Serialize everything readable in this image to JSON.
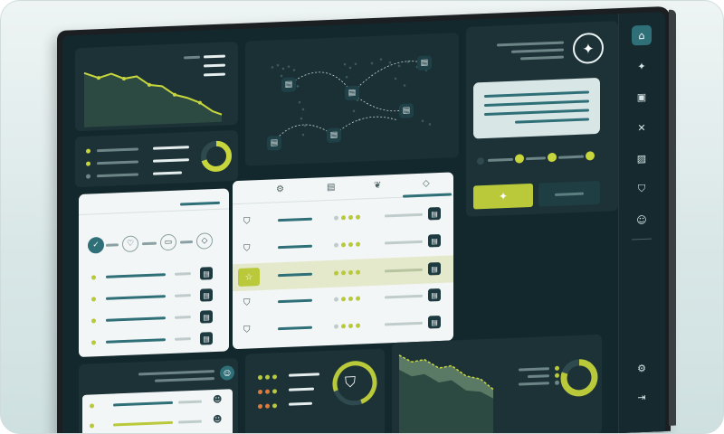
{
  "colors": {
    "background": "#d8e6e6",
    "screen": "#13282d",
    "panel": "#1c3237",
    "accent_lime": "#b9c93a",
    "accent_teal": "#2f6f78",
    "light_panel": "#f3f6f6"
  },
  "icons": {
    "sidebar": [
      "home-icon",
      "sparkle-icon",
      "clipboard-icon",
      "network-icon",
      "chart-icon",
      "shield-icon",
      "users-icon",
      "settings-icon",
      "logout-icon"
    ],
    "tabs": [
      "gear-icon",
      "factory-icon",
      "plant-icon",
      "box-icon"
    ],
    "flow": [
      "check-shield-icon",
      "heart-hands-icon",
      "document-icon",
      "box-icon"
    ]
  },
  "progress": {
    "donut_top_fraction": 0.7,
    "donut_bottom_fraction": 0.8,
    "shield_ring_fraction": 0.75,
    "slider_steps_completed": 3
  }
}
